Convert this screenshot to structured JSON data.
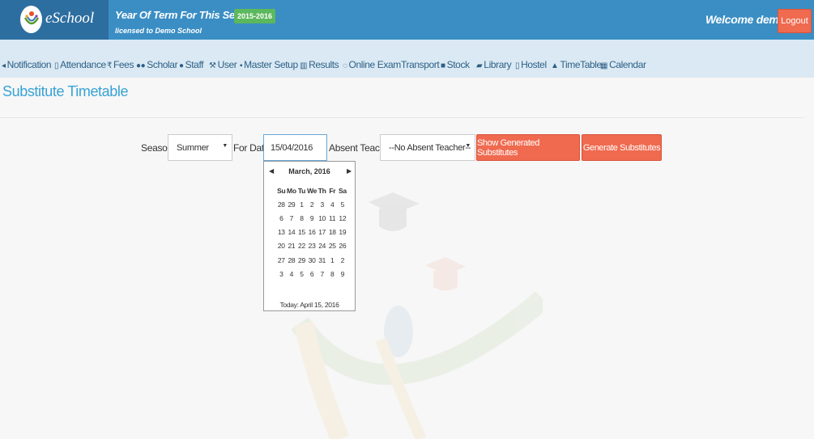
{
  "header": {
    "logo_text": "eSchool",
    "session_title": "Year Of Term For This Session :-",
    "session_badge": "2015-2016",
    "licensed": "licensed to Demo School",
    "welcome": "Welcome demo !",
    "logout_label": "Logout"
  },
  "nav": {
    "items": [
      {
        "label": "Notification",
        "icon": "bullhorn-icon"
      },
      {
        "label": "Attendance",
        "icon": "file-icon"
      },
      {
        "label": "Fees",
        "icon": "rupee-icon"
      },
      {
        "label": "Scholar",
        "icon": "users-icon"
      },
      {
        "label": "Staff",
        "icon": "user-icon"
      },
      {
        "label": "User",
        "icon": "wrench-icon"
      },
      {
        "label": "Master Setup",
        "icon": "unlock-icon"
      },
      {
        "label": "Results",
        "icon": "chart-icon"
      },
      {
        "label": "Online Exam",
        "icon": "thumbs-up-icon"
      },
      {
        "label": "Transport",
        "icon": ""
      },
      {
        "label": "Stock",
        "icon": "folder-icon"
      },
      {
        "label": "Library",
        "icon": "book-icon"
      },
      {
        "label": "Hostel",
        "icon": "building-icon"
      },
      {
        "label": "TimeTable",
        "icon": "bell-icon"
      },
      {
        "label": "Calendar",
        "icon": "calendar-icon"
      }
    ]
  },
  "page": {
    "title": "Substitute Timetable"
  },
  "form": {
    "season_label": "Season:",
    "season_value": "Summer",
    "date_label": "For Date:",
    "date_value": "15/04/2016",
    "absent_label": "Absent Teacher:",
    "absent_value": "--No Absent Teacher--",
    "show_button": "Show Generated Substitutes",
    "generate_button": "Generate Substitutes"
  },
  "datepicker": {
    "month": "March, 2016",
    "weekdays": [
      "Su",
      "Mo",
      "Tu",
      "We",
      "Th",
      "Fr",
      "Sa"
    ],
    "weeks": [
      [
        "28",
        "29",
        "1",
        "2",
        "3",
        "4",
        "5"
      ],
      [
        "6",
        "7",
        "8",
        "9",
        "10",
        "11",
        "12"
      ],
      [
        "13",
        "14",
        "15",
        "16",
        "17",
        "18",
        "19"
      ],
      [
        "20",
        "21",
        "22",
        "23",
        "24",
        "25",
        "26"
      ],
      [
        "27",
        "28",
        "29",
        "30",
        "31",
        "1",
        "2"
      ],
      [
        "3",
        "4",
        "5",
        "6",
        "7",
        "8",
        "9"
      ]
    ],
    "today": "Today: April 15, 2016"
  },
  "colors": {
    "header": "#3a8ec4",
    "nav": "#dae9f3",
    "accent": "#ef6a4f",
    "title": "#37a2d6"
  }
}
